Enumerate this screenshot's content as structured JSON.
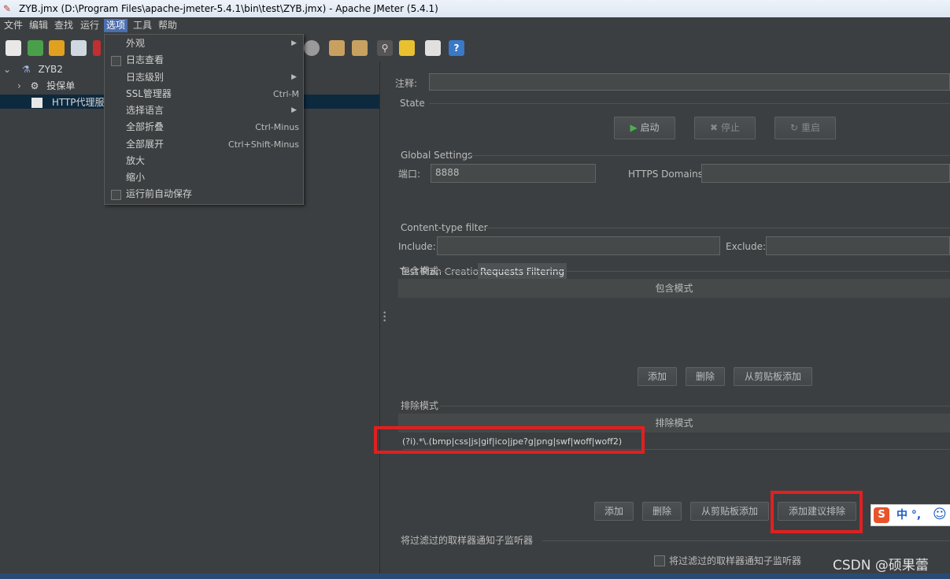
{
  "window": {
    "title": "ZYB.jmx (D:\\Program Files\\apache-jmeter-5.4.1\\bin\\test\\ZYB.jmx) - Apache JMeter (5.4.1)"
  },
  "menubar": {
    "items": [
      "文件",
      "编辑",
      "查找",
      "运行",
      "选项",
      "工具",
      "帮助"
    ]
  },
  "options_menu": {
    "items": [
      {
        "label": "外观",
        "submenu": true
      },
      {
        "label": "日志查看",
        "checkbox": true
      },
      {
        "label": "日志级别",
        "submenu": true
      },
      {
        "label": "SSL管理器",
        "shortcut": "Ctrl-M"
      },
      {
        "label": "选择语言",
        "submenu": true
      },
      {
        "label": "全部折叠",
        "shortcut": "Ctrl-Minus"
      },
      {
        "label": "全部展开",
        "shortcut": "Ctrl+Shift-Minus"
      },
      {
        "label": "放大"
      },
      {
        "label": "缩小"
      },
      {
        "label": "运行前自动保存",
        "checkbox": true
      }
    ]
  },
  "tree": {
    "root": "ZYB2",
    "children": [
      "投保单",
      "HTTP代理服务"
    ]
  },
  "panel": {
    "comment_label": "注释:",
    "state_label": "State",
    "buttons_state": {
      "start": "启动",
      "stop": "停止",
      "restart": "重启"
    },
    "global_settings_label": "Global Settings",
    "port_label": "端口:",
    "port_value": "8888",
    "https_domains_label": "HTTPS Domains:",
    "tabs": [
      "Test Plan Creation",
      "Requests Filtering"
    ],
    "content_type_filter_label": "Content-type filter",
    "include_label": "Include:",
    "exclude_label": "Exclude:",
    "include_section_label": "包含模式",
    "include_table_header": "包含模式",
    "include_buttons": {
      "add": "添加",
      "delete": "删除",
      "add_clipboard": "从剪贴板添加"
    },
    "exclude_section_label": "排除模式",
    "exclude_table_header": "排除模式",
    "exclude_rows": [
      "(?i).*\\.(bmp|css|js|gif|ico|jpe?g|png|swf|woff|woff2)"
    ],
    "exclude_buttons": {
      "add": "添加",
      "delete": "删除",
      "add_clipboard": "从剪贴板添加",
      "add_suggested": "添加建议排除"
    },
    "notify_section_label": "将过滤过的取样器通知子监听器",
    "notify_checkbox_label": "将过滤过的取样器通知子监听器"
  },
  "ime": {
    "text": "中 °,"
  },
  "watermark": "CSDN @硕果蕾",
  "colors": {
    "accent": "#4b6eaf",
    "highlight": "#e02020",
    "background": "#3c3f41"
  }
}
